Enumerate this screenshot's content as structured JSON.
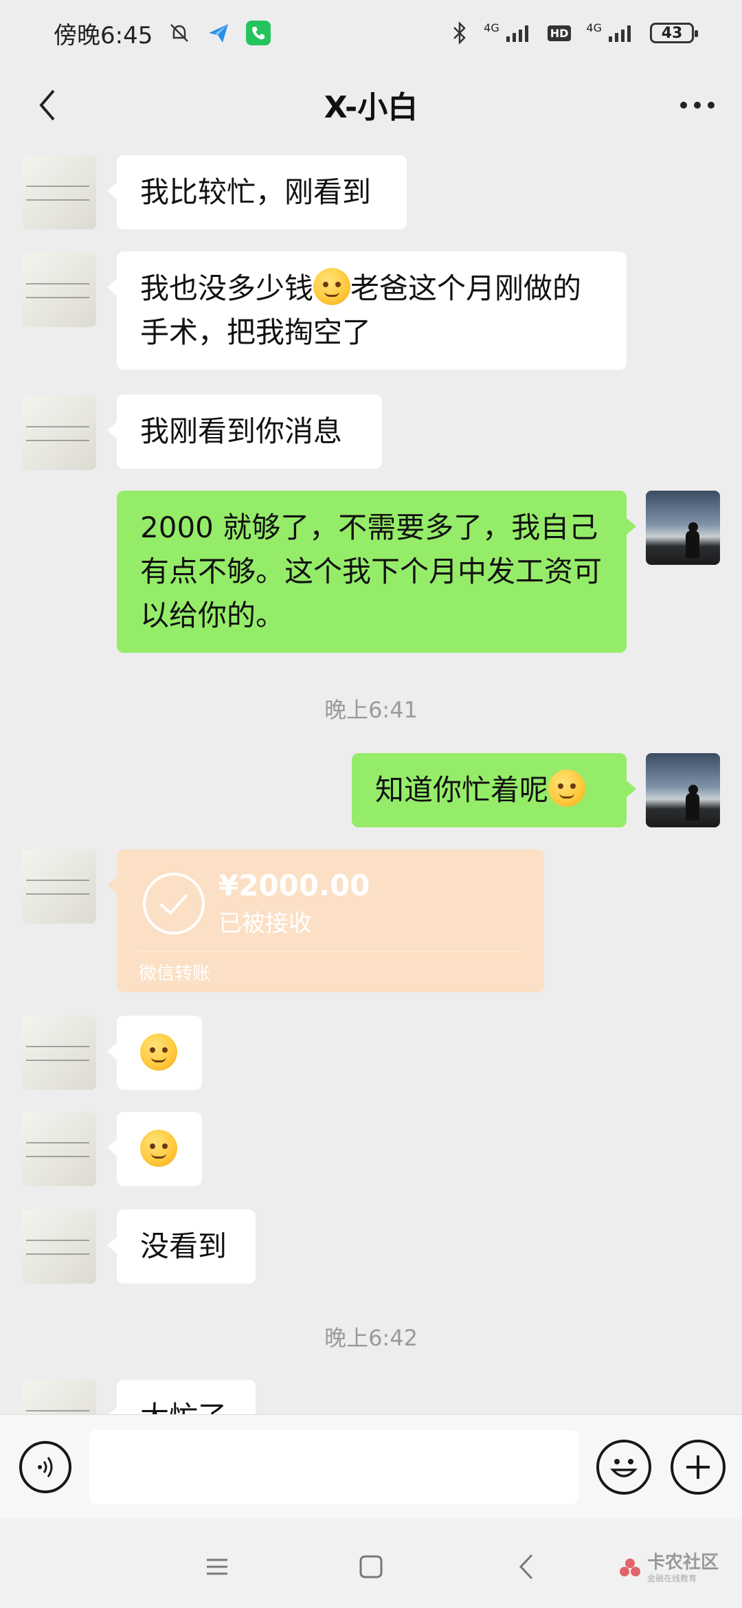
{
  "status_bar": {
    "time": "傍晚6:45",
    "network_1": "4G",
    "hd_label": "HD",
    "network_2": "4G",
    "battery": "43"
  },
  "header": {
    "title": "X-小白"
  },
  "messages": [
    {
      "side": "left",
      "text": "我比较忙，刚看到"
    },
    {
      "side": "left",
      "text_before": "我也没多少钱",
      "emoji": "crying-laughing-emoji",
      "text_after": "老爸这个月刚做的手术，把我掏空了"
    },
    {
      "side": "left",
      "text": "我刚看到你消息"
    },
    {
      "side": "right",
      "text": "2000 就够了，不需要多了，我自己有点不够。这个我下个月中发工资可以给你的。"
    },
    {
      "side": "right",
      "text": "知道你忙着呢",
      "emoji": "smiling-emoji"
    },
    {
      "side": "left",
      "emoji": "sighing-emoji"
    },
    {
      "side": "left",
      "emoji": "blushing-emoji"
    },
    {
      "side": "left",
      "text": "没看到"
    },
    {
      "side": "left",
      "text": "太忙了"
    }
  ],
  "timestamps": [
    "晚上6:41",
    "晚上6:42"
  ],
  "transfer": {
    "amount": "¥2000.00",
    "status": "已被接收",
    "source": "微信转账"
  },
  "watermark": {
    "text": "卡农社区",
    "sub": "金融在线教育"
  },
  "colors": {
    "background": "#ededed",
    "sent_bubble": "#95ec69",
    "received_bubble": "#ffffff",
    "transfer_card": "#fbe0c5",
    "timestamp": "#9a9a9a"
  }
}
